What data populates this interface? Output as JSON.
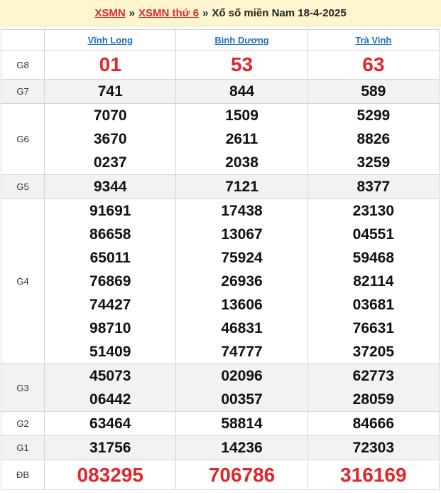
{
  "header": {
    "link1": "XSMN",
    "link2": "XSMN thứ 6",
    "separator": "»",
    "title": "Xổ số miền Nam 18-4-2025"
  },
  "provinces": [
    "Vĩnh Long",
    "Bình Dương",
    "Trà Vinh"
  ],
  "prizes": [
    {
      "label": "G8",
      "values": [
        [
          "01"
        ],
        [
          "53"
        ],
        [
          "63"
        ]
      ]
    },
    {
      "label": "G7",
      "values": [
        [
          "741"
        ],
        [
          "844"
        ],
        [
          "589"
        ]
      ]
    },
    {
      "label": "G6",
      "values": [
        [
          "7070",
          "3670",
          "0237"
        ],
        [
          "1509",
          "2611",
          "2038"
        ],
        [
          "5299",
          "8826",
          "3259"
        ]
      ]
    },
    {
      "label": "G5",
      "values": [
        [
          "9344"
        ],
        [
          "7121"
        ],
        [
          "8377"
        ]
      ]
    },
    {
      "label": "G4",
      "values": [
        [
          "91691",
          "86658",
          "65011",
          "76869",
          "74427",
          "98710",
          "51409"
        ],
        [
          "17438",
          "13067",
          "75924",
          "26936",
          "13606",
          "46831",
          "74777"
        ],
        [
          "23130",
          "04551",
          "59468",
          "82114",
          "03681",
          "76631",
          "37205"
        ]
      ]
    },
    {
      "label": "G3",
      "values": [
        [
          "45073",
          "06442"
        ],
        [
          "02096",
          "00357"
        ],
        [
          "62773",
          "28059"
        ]
      ]
    },
    {
      "label": "G2",
      "values": [
        [
          "63464"
        ],
        [
          "58814"
        ],
        [
          "84666"
        ]
      ]
    },
    {
      "label": "G1",
      "values": [
        [
          "31756"
        ],
        [
          "14236"
        ],
        [
          "72303"
        ]
      ]
    },
    {
      "label": "ĐB",
      "values": [
        [
          "083295"
        ],
        [
          "706786"
        ],
        [
          "316169"
        ]
      ]
    }
  ],
  "colors": {
    "accent_red": "#e0262b",
    "link_blue": "#2270b8",
    "header_bg": "#fff5cf",
    "row_shade": "#f2f2f2"
  }
}
